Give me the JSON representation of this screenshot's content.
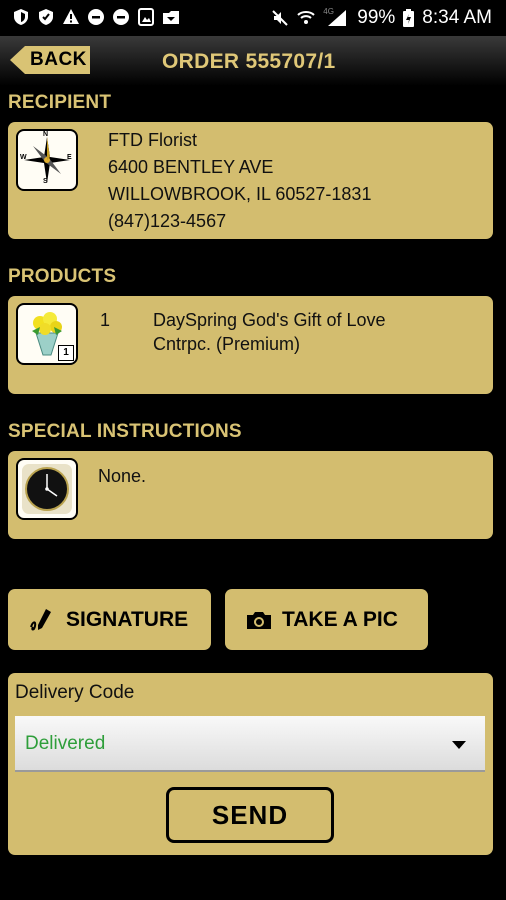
{
  "status_bar": {
    "battery_percent": "99%",
    "time": "8:34 AM",
    "signal_label": "4G",
    "left_icons": [
      "shield-icon",
      "shield-icon",
      "warning-icon",
      "record-icon",
      "record-icon",
      "image-icon",
      "folder-icon"
    ],
    "right_icons": [
      "mute-icon",
      "wifi-icon",
      "signal-icon",
      "battery-icon"
    ]
  },
  "header": {
    "back_label": "BACK",
    "title": "ORDER 555707/1"
  },
  "recipient": {
    "heading": "RECIPIENT",
    "name": "FTD Florist",
    "address1": "6400 BENTLEY AVE",
    "address2": "WILLOWBROOK, IL 60527-1831",
    "phone": "(847)123-4567",
    "icon": "compass-icon",
    "compass_labels": [
      "N",
      "W",
      "E",
      "S"
    ]
  },
  "products": {
    "heading": "PRODUCTS",
    "items": [
      {
        "qty": "1",
        "name": "DaySpring God's Gift of Love Cntrpc. (Premium)",
        "badge": "1",
        "icon": "flower-vase-icon"
      }
    ]
  },
  "instructions": {
    "heading": "SPECIAL INSTRUCTIONS",
    "text": "None.",
    "icon": "clock-icon"
  },
  "actions": {
    "signature_label": "SIGNATURE",
    "take_pic_label": "TAKE A PIC"
  },
  "delivery": {
    "label": "Delivery Code",
    "selected": "Delivered",
    "send_label": "SEND"
  },
  "colors": {
    "card": "#d3bd6f",
    "heading": "#d9c374",
    "delivered_text": "#2e9e3a",
    "background": "#000000"
  }
}
